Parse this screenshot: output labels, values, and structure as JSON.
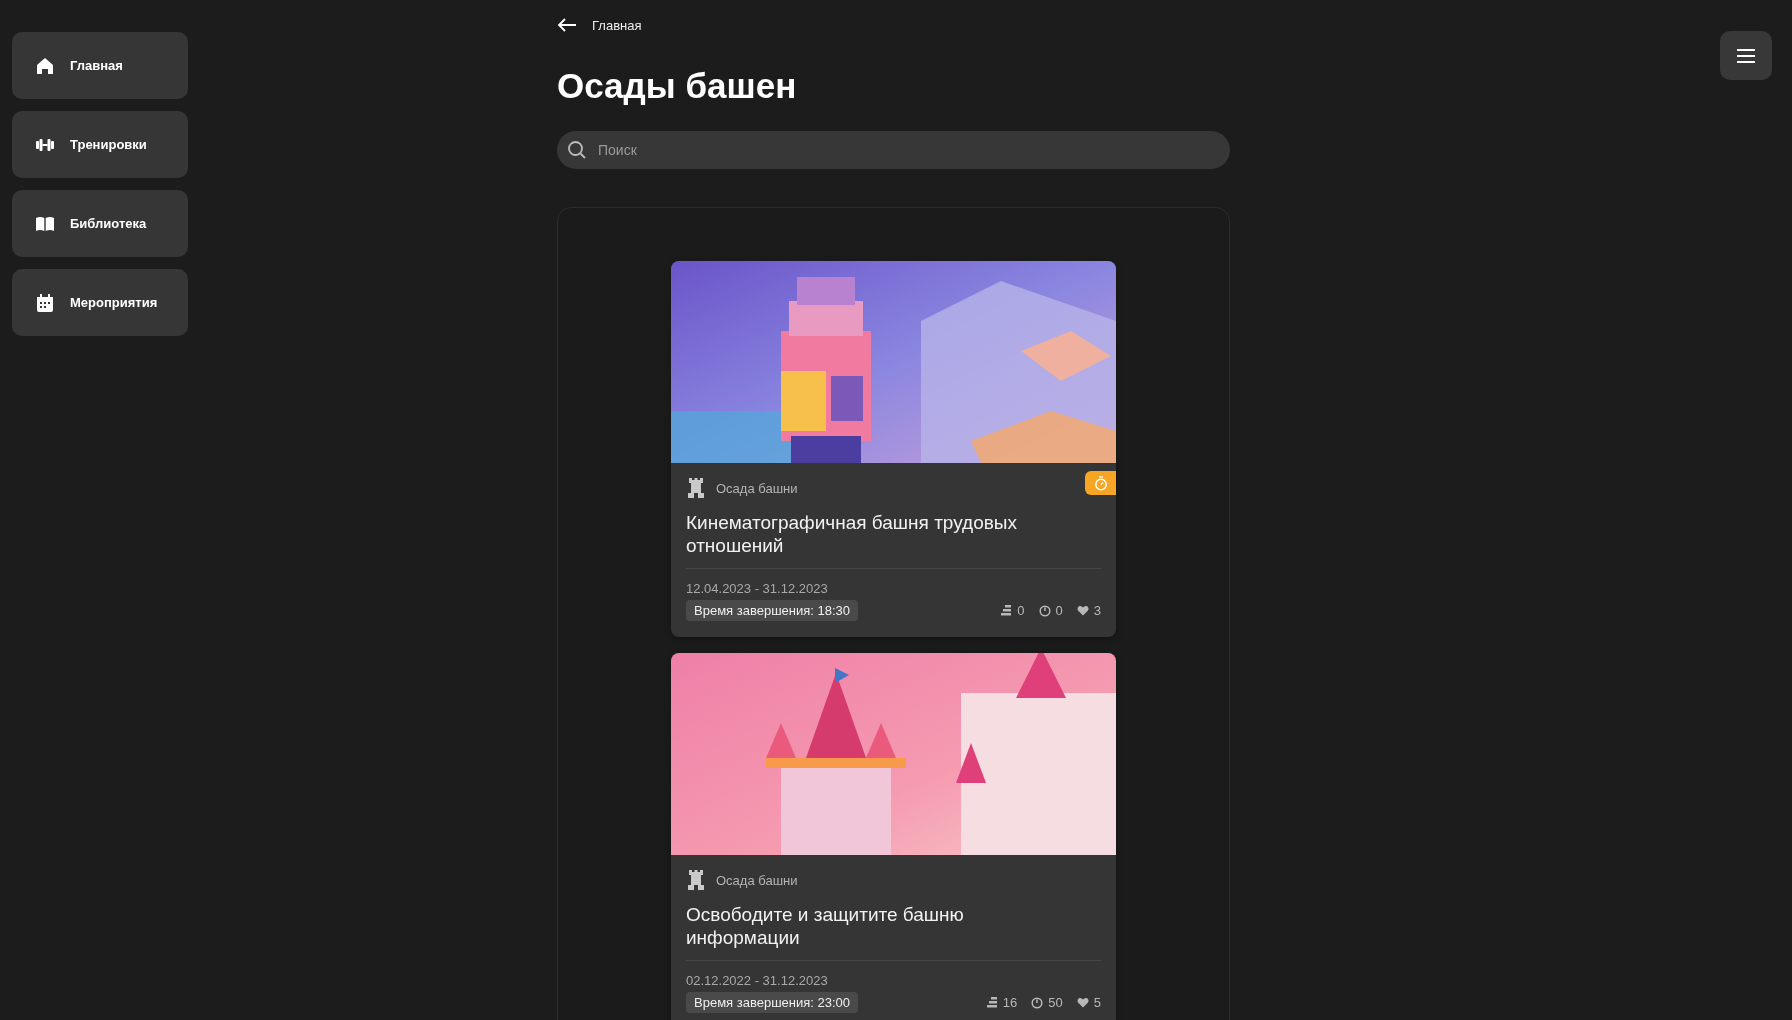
{
  "sidebar": {
    "items": [
      {
        "label": "Главная"
      },
      {
        "label": "Тренировки"
      },
      {
        "label": "Библиотека"
      },
      {
        "label": "Мероприятия"
      }
    ]
  },
  "breadcrumb": {
    "label": "Главная"
  },
  "title": "Осады башен",
  "search": {
    "placeholder": "Поиск"
  },
  "cards": [
    {
      "category": "Осада башни",
      "timer": true,
      "title": "Кинематографичная башня трудовых отношений",
      "dates": "12.04.2023 - 31.12.2023",
      "end_time": "Время завершения: 18:30",
      "stats": [
        {
          "kind": "levels",
          "value": "0"
        },
        {
          "kind": "attempts",
          "value": "0"
        },
        {
          "kind": "likes",
          "value": "3"
        }
      ]
    },
    {
      "category": "Осада башни",
      "timer": false,
      "title": "Освободите и защитите башню информации",
      "dates": "02.12.2022 - 31.12.2023",
      "end_time": "Время завершения: 23:00",
      "stats": [
        {
          "kind": "levels",
          "value": "16"
        },
        {
          "kind": "attempts",
          "value": "50"
        },
        {
          "kind": "likes",
          "value": "5"
        }
      ]
    }
  ]
}
